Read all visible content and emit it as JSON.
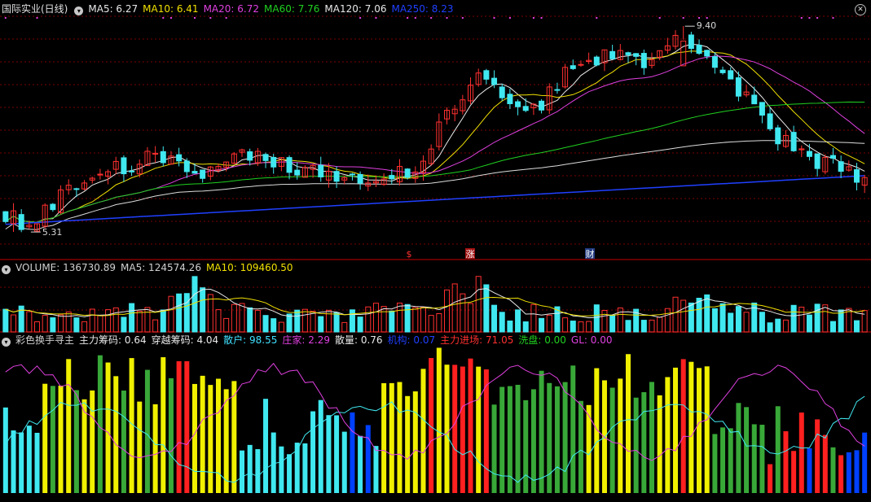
{
  "price_header": {
    "title": "国际实业(日线)",
    "ma_items": [
      {
        "label": "MA5: 6.27",
        "color": "#e8e8e8"
      },
      {
        "label": "MA10: 6.41",
        "color": "#f0e000"
      },
      {
        "label": "MA20: 6.72",
        "color": "#e040e0"
      },
      {
        "label": "MA60: 7.76",
        "color": "#20d020"
      },
      {
        "label": "MA120: 7.06",
        "color": "#e8e8e8"
      },
      {
        "label": "MA250: 8.23",
        "color": "#2040ff"
      }
    ]
  },
  "volume_header": {
    "title": "VOLUME: 136730.89",
    "ma5": "MA5: 124574.26",
    "ma10": "MA10: 109460.50"
  },
  "indicator_header": {
    "title": "彩色换手寻主",
    "items": [
      {
        "label": "主力筹码: 0.64",
        "color": "#e8e8e8"
      },
      {
        "label": "穿越筹码: 4.04",
        "color": "#e8e8e8"
      },
      {
        "label": "散户: 98.55",
        "color": "#40e0ff"
      },
      {
        "label": "庄家: 2.29",
        "color": "#e040e0"
      },
      {
        "label": "散量: 0.76",
        "color": "#e8e8e8"
      },
      {
        "label": "机构: 0.07",
        "color": "#2040ff"
      },
      {
        "label": "主力进场: 71.05",
        "color": "#ff3030"
      },
      {
        "label": "洗盘: 0.00",
        "color": "#20d020"
      },
      {
        "label": "GL: 0.00",
        "color": "#e040e0"
      }
    ]
  },
  "annotations": {
    "high_label": "9.40",
    "low_label": "5.31",
    "markers": [
      {
        "text": "$",
        "color": "#ff3030"
      },
      {
        "text": "涨",
        "color": "#ffffff",
        "bg": "#a01010"
      },
      {
        "text": "财",
        "color": "#ffffff",
        "bg": "#203a80"
      }
    ]
  },
  "chart_data": {
    "type": "candlestick",
    "candle_count": 110,
    "price_range": [
      5.0,
      9.6
    ],
    "high": 9.4,
    "low": 5.31,
    "seed": 20240617,
    "colors": {
      "up": "#ff3030",
      "down": "#40e8f0",
      "bg": "#000000",
      "grid": "#7a0000"
    }
  }
}
